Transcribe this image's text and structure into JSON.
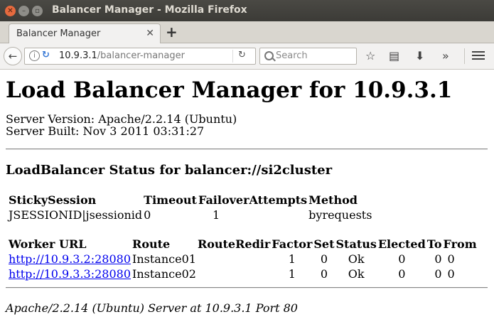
{
  "window": {
    "title": "Balancer Manager - Mozilla Firefox"
  },
  "tab": {
    "label": "Balancer Manager"
  },
  "navbar": {
    "url_host": "10.9.3.1",
    "url_path": "/balancer-manager",
    "search_placeholder": "Search",
    "icons": [
      "back-arrow-icon",
      "info-icon",
      "reload-icon",
      "search-icon",
      "star-icon",
      "reading-list-icon",
      "download-icon",
      "overflow-icon",
      "menu-icon"
    ]
  },
  "page": {
    "title": "Load Balancer Manager for 10.9.3.1",
    "server_version": "Server Version: Apache/2.2.14 (Ubuntu)",
    "server_built": "Server Built: Nov 3 2011 03:31:27",
    "status_heading": "LoadBalancer Status for balancer://si2cluster",
    "balancer_table": {
      "headers": [
        "StickySession",
        "Timeout",
        "FailoverAttempts",
        "Method"
      ],
      "row": [
        "JSESSIONID|jsessionid",
        "0",
        "1",
        "byrequests"
      ]
    },
    "worker_table": {
      "headers": [
        "Worker URL",
        "Route",
        "RouteRedir",
        "Factor",
        "Set",
        "Status",
        "Elected",
        "To",
        "From"
      ],
      "rows": [
        [
          "http://10.9.3.2:28080",
          "Instance01",
          "",
          "1",
          "0",
          "Ok",
          "0",
          "0",
          "0"
        ],
        [
          "http://10.9.3.3:28080",
          "Instance02",
          "",
          "1",
          "0",
          "Ok",
          "0",
          "0",
          "0"
        ]
      ]
    },
    "footer": "Apache/2.2.14 (Ubuntu) Server at 10.9.3.1 Port 80"
  },
  "colors": {
    "link": "#0000ee",
    "titlebar": "#3c3b37",
    "close_button": "#e66a3e"
  }
}
